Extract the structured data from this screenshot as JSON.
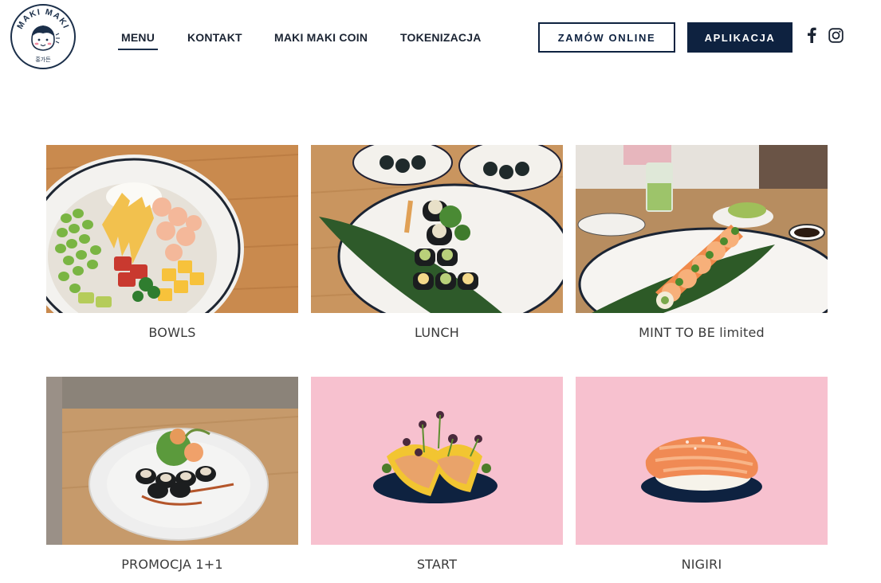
{
  "logo": {
    "arc_text": "MAKI MAKI",
    "sub_text": "홍가든"
  },
  "nav": {
    "items": [
      {
        "label": "MENU",
        "active": true
      },
      {
        "label": "KONTAKT",
        "active": false
      },
      {
        "label": "MAKI MAKI COIN",
        "active": false
      },
      {
        "label": "TOKENIZACJA",
        "active": false
      }
    ]
  },
  "header": {
    "order_label": "ZAMÓW ONLINE",
    "app_label": "APLIKACJA"
  },
  "social": {
    "facebook_icon": "facebook-icon",
    "instagram_icon": "instagram-icon"
  },
  "menu": {
    "categories": [
      {
        "label": "BOWLS"
      },
      {
        "label": "LUNCH"
      },
      {
        "label": "MINT TO BE limited"
      },
      {
        "label": "PROMOCJA 1+1"
      },
      {
        "label": "START"
      },
      {
        "label": "NIGIRI"
      }
    ]
  },
  "colors": {
    "navy": "#0e2240",
    "pink": "#f7c1cf",
    "wood": "#c8864a"
  }
}
